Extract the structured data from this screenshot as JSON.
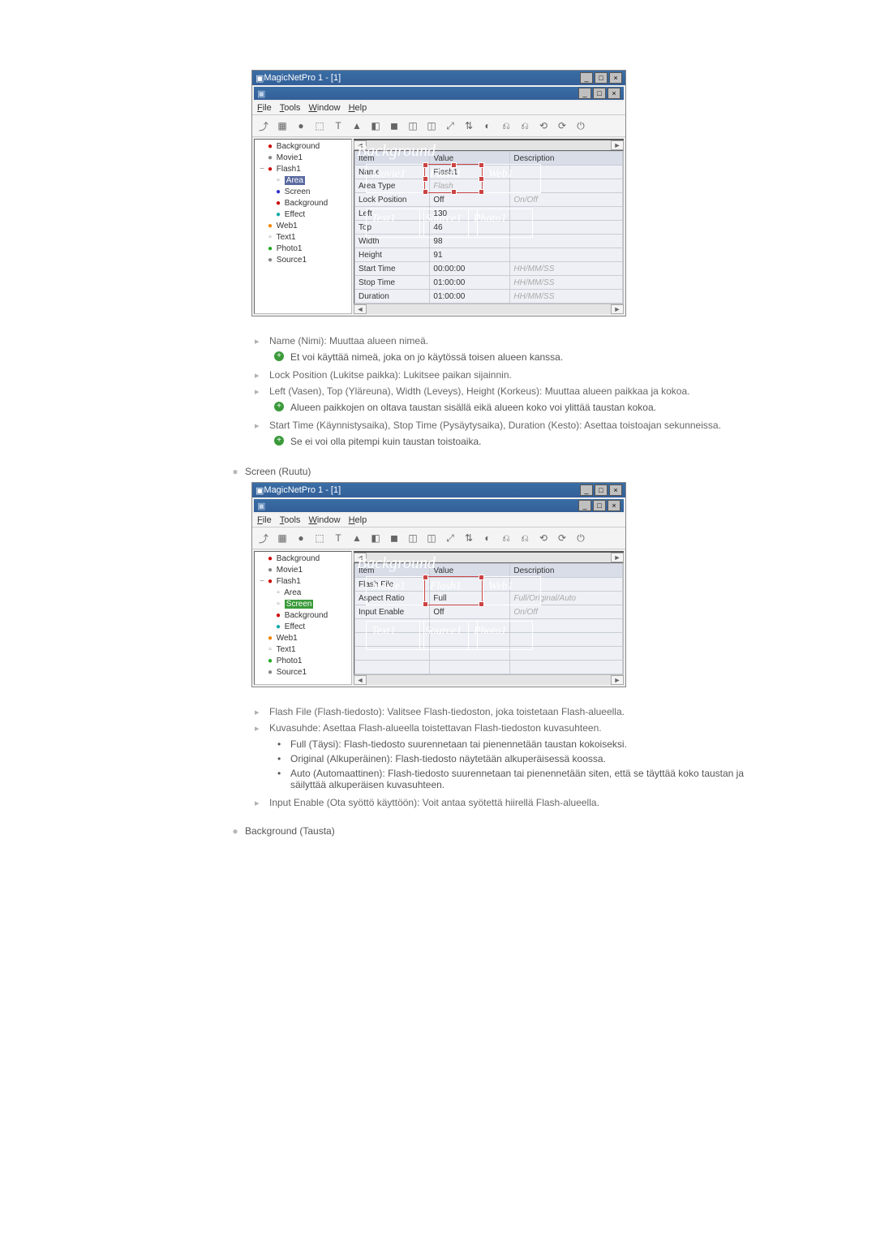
{
  "app": {
    "title": "MagicNetPro 1 - [1]",
    "min": "_",
    "max": "□",
    "close": "×"
  },
  "menu": {
    "file": "File",
    "tools": "Tools",
    "window": "Window",
    "help": "Help"
  },
  "toolbar_icons": [
    "⤴",
    "▦",
    "●",
    "⬚",
    "T",
    "▲",
    "◧",
    "◼",
    "◫",
    "◫",
    "⤢",
    "⇅",
    "◐",
    "⎌",
    "⎌",
    "⟲",
    "⟳",
    "⏻"
  ],
  "tree": {
    "items": [
      {
        "label": "Background",
        "icon": "red"
      },
      {
        "label": "Movie1",
        "icon": "gray"
      },
      {
        "label": "Flash1",
        "icon": "red",
        "expanded": true,
        "children": [
          {
            "label": "Area",
            "selected": "sel-b"
          },
          {
            "label": "Screen",
            "icon": "blue"
          },
          {
            "label": "Background",
            "icon": "red"
          },
          {
            "label": "Effect",
            "icon": "cyan"
          }
        ]
      },
      {
        "label": "Web1",
        "icon": "orange"
      },
      {
        "label": "Text1"
      },
      {
        "label": "Photo1",
        "icon": "green"
      },
      {
        "label": "Source1",
        "icon": "gray"
      }
    ],
    "items2": [
      {
        "label": "Background",
        "icon": "red"
      },
      {
        "label": "Movie1",
        "icon": "gray"
      },
      {
        "label": "Flash1",
        "icon": "red",
        "expanded": true,
        "children": [
          {
            "label": "Area"
          },
          {
            "label": "Screen",
            "selected": "sel-g"
          },
          {
            "label": "Background",
            "icon": "red"
          },
          {
            "label": "Effect",
            "icon": "cyan"
          }
        ]
      },
      {
        "label": "Web1",
        "icon": "orange"
      },
      {
        "label": "Text1"
      },
      {
        "label": "Photo1",
        "icon": "green"
      },
      {
        "label": "Source1",
        "icon": "gray"
      }
    ]
  },
  "canvas": {
    "bg": "Background",
    "movie1": "Movie1",
    "flash1": "Flash1",
    "web1": "Web1",
    "text1": "Text1",
    "source1": "Source1",
    "photo1": "Photo1"
  },
  "grid1": {
    "headers": {
      "item": "Item",
      "value": "Value",
      "desc": "Description"
    },
    "rows": [
      {
        "item": "Name",
        "value": "Flash1",
        "desc": ""
      },
      {
        "item": "Area Type",
        "value": "Flash",
        "desc": "",
        "gray": true
      },
      {
        "item": "Lock Position",
        "value": "Off",
        "desc": "On/Off",
        "grayd": true
      },
      {
        "item": "Left",
        "value": "130",
        "desc": ""
      },
      {
        "item": "Top",
        "value": "46",
        "desc": ""
      },
      {
        "item": "Width",
        "value": "98",
        "desc": ""
      },
      {
        "item": "Height",
        "value": "91",
        "desc": ""
      },
      {
        "item": "Start Time",
        "value": "00:00:00",
        "desc": "HH/MM/SS",
        "grayd": true
      },
      {
        "item": "Stop Time",
        "value": "01:00:00",
        "desc": "HH/MM/SS",
        "grayd": true
      },
      {
        "item": "Duration",
        "value": "01:00:00",
        "desc": "HH/MM/SS",
        "grayd": true
      }
    ]
  },
  "grid2": {
    "headers": {
      "item": "Item",
      "value": "Value",
      "desc": "Description"
    },
    "rows": [
      {
        "item": "Flash File",
        "value": "",
        "desc": ""
      },
      {
        "item": "Aspect Ratio",
        "value": "Full",
        "desc": "Full/Original/Auto",
        "grayd": true
      },
      {
        "item": "Input Enable",
        "value": "Off",
        "desc": "On/Off",
        "grayd": true
      },
      {
        "item": "",
        "value": "",
        "desc": ""
      },
      {
        "item": "",
        "value": "",
        "desc": ""
      },
      {
        "item": "",
        "value": "",
        "desc": ""
      },
      {
        "item": "",
        "value": "",
        "desc": ""
      }
    ]
  },
  "doc1": [
    {
      "text": "Name (Nimi): Muuttaa alueen nimeä.",
      "sub": [
        {
          "type": "note",
          "text": "Et voi käyttää nimeä, joka on jo käytössä toisen alueen kanssa."
        }
      ]
    },
    {
      "text": "Lock Position (Lukitse paikka): Lukitsee paikan sijainnin."
    },
    {
      "text": "Left (Vasen), Top (Yläreuna), Width (Leveys), Height (Korkeus): Muuttaa alueen paikkaa ja kokoa.",
      "sub": [
        {
          "type": "note",
          "text": "Alueen paikkojen on oltava taustan sisällä eikä alueen koko voi ylittää taustan kokoa."
        }
      ]
    },
    {
      "text": "Start Time (Käynnistysaika), Stop Time (Pysäytysaika), Duration (Kesto): Asettaa toistoajan sekunneissa.",
      "sub": [
        {
          "type": "note",
          "text": "Se ei voi olla pitempi kuin taustan toistoaika."
        }
      ]
    }
  ],
  "sec_screen": "Screen (Ruutu)",
  "doc2": [
    {
      "text": "Flash File (Flash-tiedosto): Valitsee Flash-tiedoston, joka toistetaan Flash-alueella."
    },
    {
      "text": "Kuvasuhde: Asettaa Flash-alueella toistettavan Flash-tiedoston kuvasuhteen.",
      "sub": [
        {
          "type": "bul",
          "text": "Full (Täysi): Flash-tiedosto suurennetaan tai pienennetään taustan kokoiseksi."
        },
        {
          "type": "bul",
          "text": "Original (Alkuperäinen): Flash-tiedosto näytetään alkuperäisessä koossa."
        },
        {
          "type": "bul",
          "text": "Auto (Automaattinen): Flash-tiedosto suurennetaan tai pienennetään siten, että se täyttää koko taustan ja säilyttää alkuperäisen kuvasuhteen."
        }
      ]
    },
    {
      "text": "Input Enable (Ota syöttö käyttöön): Voit antaa syötettä hiirellä Flash-alueella."
    }
  ],
  "sec_bg": "Background (Tausta)"
}
